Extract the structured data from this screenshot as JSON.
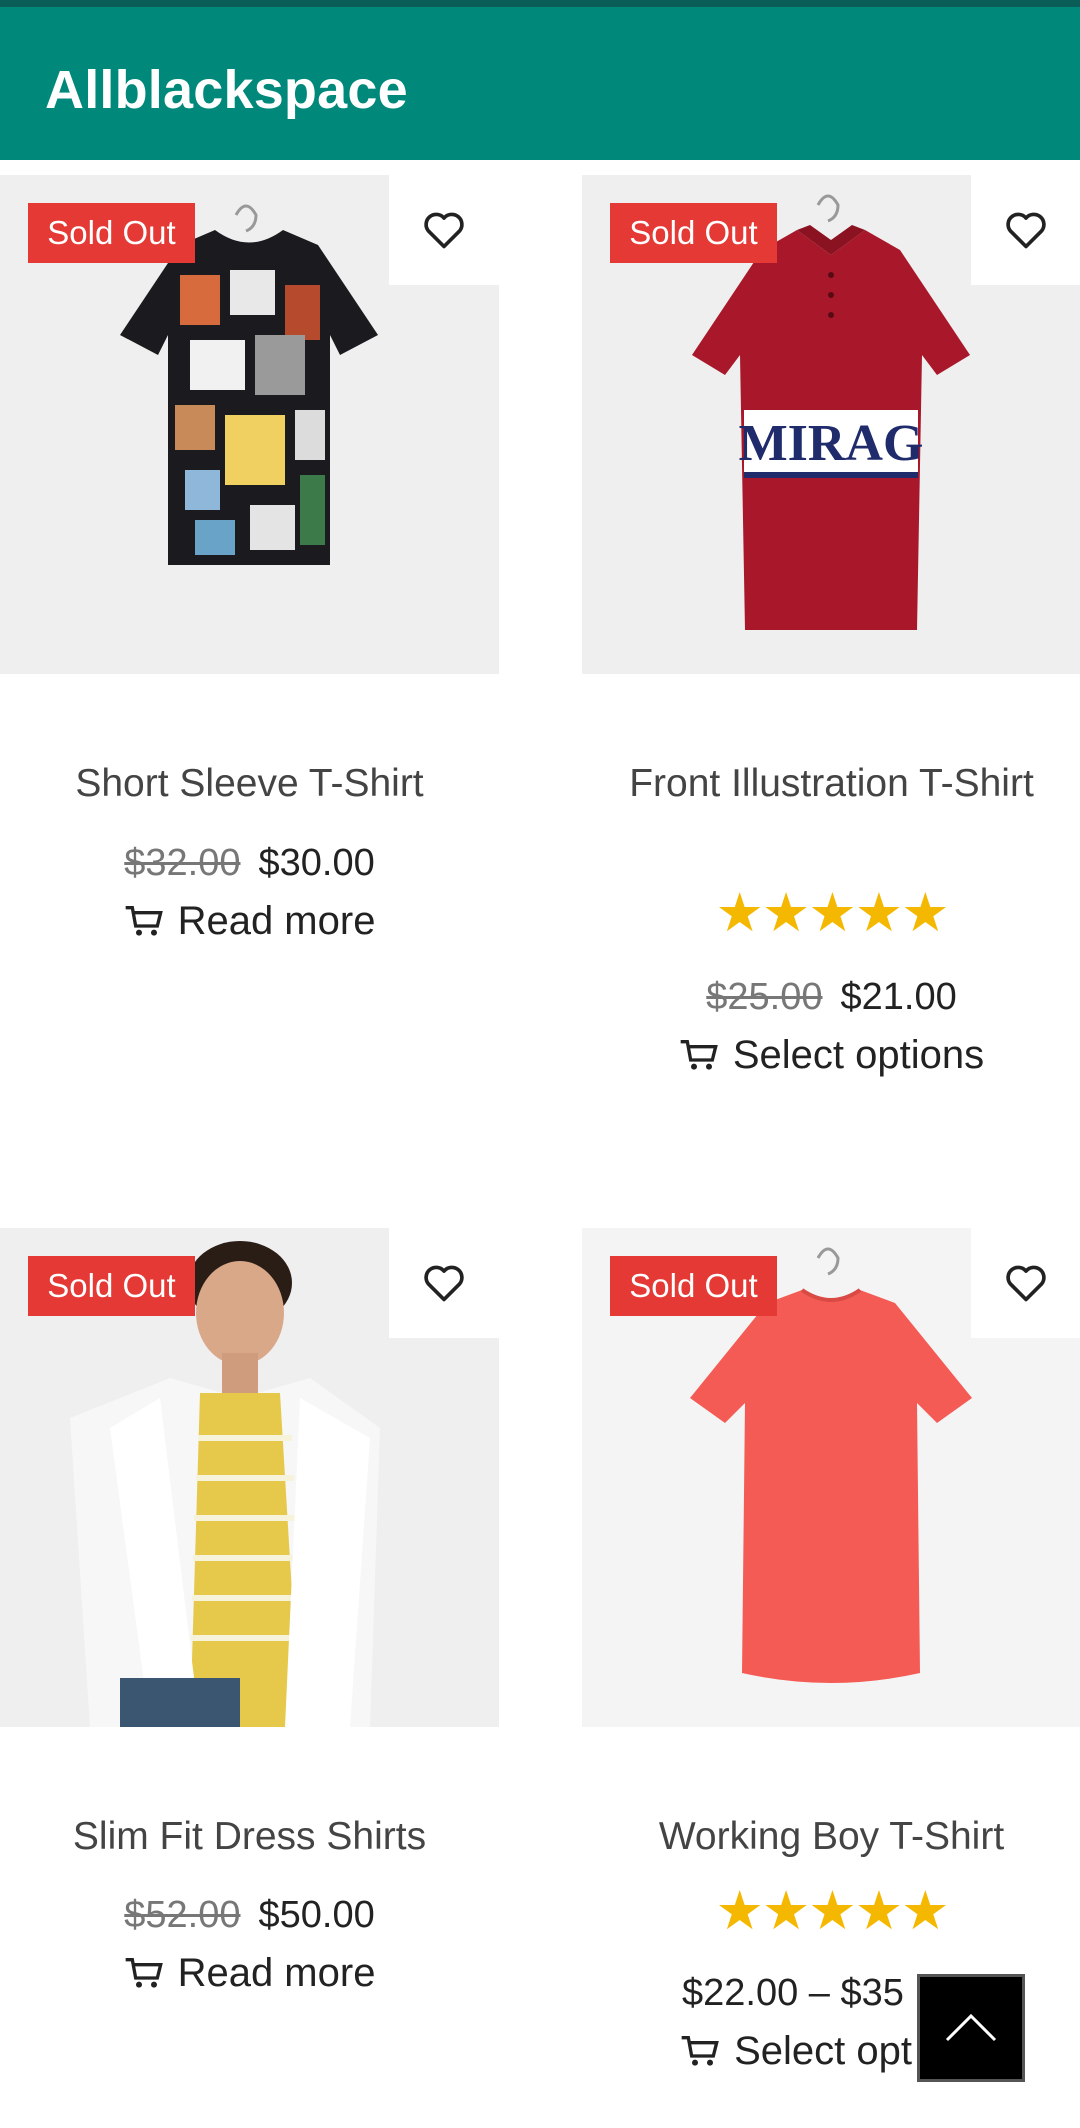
{
  "app": {
    "title": "Allblackspace"
  },
  "products": [
    {
      "badge": "Sold Out",
      "name": "Short Sleeve T-Shirt",
      "old_price": "$32.00",
      "price": "$30.00",
      "action": "Read more",
      "image": "black-printed-tshirt",
      "rating": null
    },
    {
      "badge": "Sold Out",
      "name": "Front Illustration T-Shirt",
      "stars": "★★★★★",
      "rating": 5,
      "old_price": "$25.00",
      "price": "$21.00",
      "action": "Select options",
      "image": "red-polo-mirage",
      "shirt_text": "MIRAG"
    },
    {
      "badge": "Sold Out",
      "name": "Slim Fit Dress Shirts",
      "old_price": "$52.00",
      "price": "$50.00",
      "action": "Read more",
      "image": "white-shirt-model",
      "rating": null
    },
    {
      "badge": "Sold Out",
      "name": "Working Boy T-Shirt",
      "stars": "★★★★★",
      "rating": 5,
      "price_range": "$22.00 – $35",
      "action": "Select opt",
      "image": "coral-tshirt"
    }
  ],
  "colors": {
    "header": "#00897b",
    "badge": "#e53935",
    "star": "#f5b800"
  },
  "icons": {
    "wishlist": "heart-icon",
    "cart": "cart-icon",
    "scroll_top": "chevron-up-icon"
  }
}
